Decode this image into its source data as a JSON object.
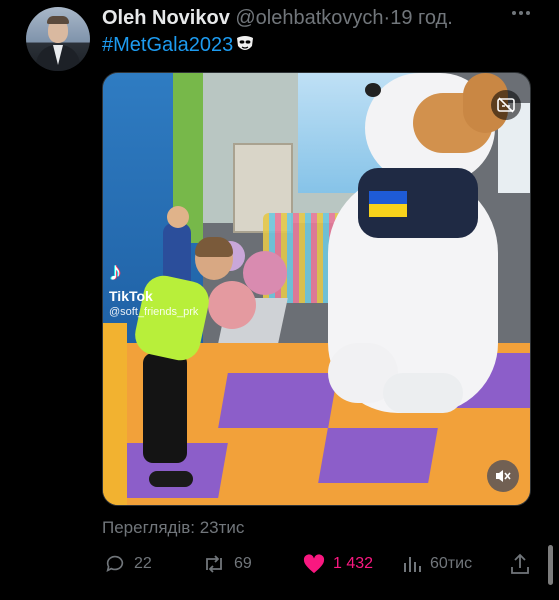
{
  "author": {
    "name": "Oleh Novikov",
    "handle": "@olehbatkovych",
    "separator": "·",
    "time": "19 год."
  },
  "tweet": {
    "text": "#MetGala2023",
    "emoji": "mask-icon"
  },
  "media": {
    "watermark_logo": "♪",
    "watermark_brand": "TikTok",
    "watermark_user": "@soft_friends_prk",
    "caption_icon": "captions-off-icon",
    "mute_icon": "volume-mute-icon"
  },
  "views": "Переглядів: 23тис",
  "actions": {
    "replies": "22",
    "retweets": "69",
    "likes": "1 432",
    "analytics": "60тис"
  },
  "colors": {
    "background": "#000000",
    "text": "#e7e9ea",
    "muted": "#71767b",
    "hashtag": "#1d9bf0",
    "like": "#f91880"
  }
}
